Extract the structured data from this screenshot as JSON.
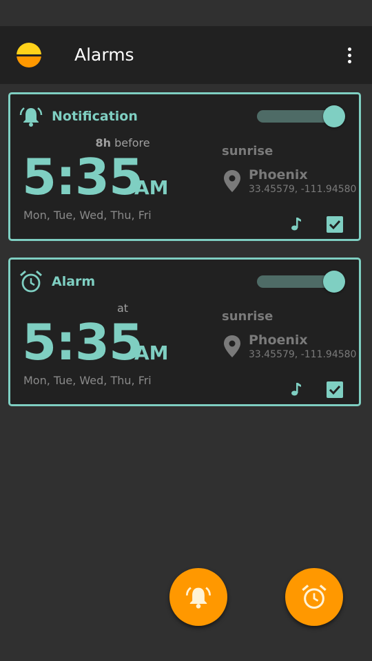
{
  "appbar": {
    "title": "Alarms",
    "icon": "sun-horizon-icon",
    "menu_icon": "more-vert-icon"
  },
  "colors": {
    "accent": "#7fcfc2",
    "fab": "#ff9800",
    "appbar": "#212121",
    "background": "#303030"
  },
  "cards": [
    {
      "type_label": "Notification",
      "type_icon": "bell-ring-icon",
      "enabled": true,
      "offset_value": "8h",
      "offset_text": "before",
      "time": "5:35",
      "ampm": "AM",
      "days": "Mon, Tue, Wed, Thu, Fri",
      "event": "sunrise",
      "city": "Phoenix",
      "coords": "33.45579, -111.94580",
      "sound_icon": "music-note-icon",
      "check_icon": "check-box-icon"
    },
    {
      "type_label": "Alarm",
      "type_icon": "alarm-clock-icon",
      "enabled": true,
      "offset_value": "",
      "offset_text": "at",
      "time": "5:35",
      "ampm": "AM",
      "days": "Mon, Tue, Wed, Thu, Fri",
      "event": "sunrise",
      "city": "Phoenix",
      "coords": "33.45579, -111.94580",
      "sound_icon": "music-note-icon",
      "check_icon": "check-box-icon"
    }
  ],
  "fabs": [
    {
      "icon": "add-notification-icon"
    },
    {
      "icon": "add-alarm-icon"
    }
  ]
}
